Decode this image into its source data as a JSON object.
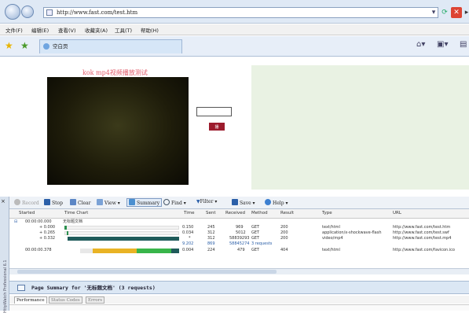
{
  "browser": {
    "url": "http://www.fast.com/test.htm",
    "menu": [
      "文件(F)",
      "编辑(E)",
      "查看(V)",
      "收藏夹(A)",
      "工具(T)",
      "帮助(H)"
    ],
    "tab_title": "空白页"
  },
  "page": {
    "title": "kok mp4视频播放测试",
    "play_button": "播放"
  },
  "httpwatch": {
    "toolbar": {
      "record": "Record",
      "stop": "Stop",
      "clear": "Clear",
      "view": "View",
      "summary": "Summary",
      "find": "Find",
      "filter": "Filter",
      "save": "Save",
      "help": "Help"
    },
    "columns": [
      "Started",
      "Time Chart",
      "Time",
      "Sent",
      "Received",
      "Method",
      "Result",
      "Type",
      "URL"
    ],
    "group1": {
      "started": "00:00:00.000",
      "label": "无标题文档"
    },
    "rows": [
      {
        "started": "+ 0.000",
        "time": "0.150",
        "sent": "245",
        "received": "969",
        "method": "GET",
        "result": "200",
        "type": "text/html",
        "url": "http://www.fast.com/test.htm"
      },
      {
        "started": "+ 0.265",
        "time": "0.034",
        "sent": "312",
        "received": "5012",
        "method": "GET",
        "result": "200",
        "type": "application/x-shockwave-flash",
        "url": "http://www.fast.com/test.swf"
      },
      {
        "started": "+ 0.332",
        "time": "*",
        "sent": "312",
        "received": "58839293",
        "method": "GET",
        "result": "200",
        "type": "video/mp4",
        "url": "http://www.fast.com/test.mp4"
      }
    ],
    "totals": {
      "time": "9.202",
      "sent": "869",
      "received": "58845274",
      "method": "3 requests"
    },
    "row4": {
      "started": "00:00:00.378",
      "time": "0.004",
      "sent": "224",
      "received": "479",
      "method": "GET",
      "result": "404",
      "type": "text/html",
      "url": "http://www.fast.com/favicon.ico"
    },
    "summary_title": "Page Summary for '无标题文档' (3 requests)",
    "tabs": [
      "Performance",
      "Status Codes",
      "Errors"
    ],
    "side_label": "HttpWatch Professional 6.1"
  }
}
